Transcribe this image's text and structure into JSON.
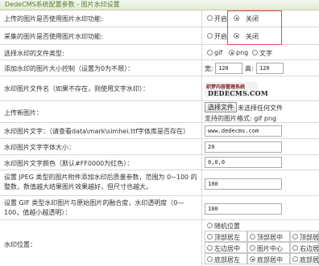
{
  "header": {
    "title": "DedeCMS系统配置参数 - 图片水印设置"
  },
  "rows": {
    "upload_wm": {
      "label": "上传的图片是否使用图片水印功能:",
      "opt_on": "开启",
      "opt_off": "关闭"
    },
    "collect_wm": {
      "label": "采集的图片是否使用图片水印功能:",
      "opt_on": "开启",
      "opt_off": "关闭"
    },
    "wm_type": {
      "label": "选择水印的文件类型:",
      "opt_gif": "gif",
      "opt_png": "png",
      "opt_text": "文字"
    },
    "wm_size": {
      "label": "添加水印的图片大小控制（设置为0为不限）：",
      "width_label": "宽:",
      "width": "120",
      "height_label": "高:",
      "height": "120"
    },
    "wm_file": {
      "label": "水印图片文件名（如果不存在，则使用文字水印）：",
      "preview_line1": "织梦内容管理系统",
      "preview_line2": "DEDECMS.COM"
    },
    "upload_new": {
      "label": "上传新图片：",
      "choose_btn": "选择文件",
      "no_file": "未选择任何文件",
      "support": "支持的图片格式: gif png"
    },
    "wm_text": {
      "label": "水印图片文字：（请查看data\\mark\\simhei.ttf字体库是否存在）",
      "value": "www.dedecms.com"
    },
    "wm_text_size": {
      "label": "水印图片文字字体大小：",
      "value": "20"
    },
    "wm_text_color": {
      "label": "水印图片文字颜色（默认#FF0000为红色）：",
      "value": "0,0,0"
    },
    "jpeg_quality": {
      "label": "设置 JPEG 类型的图片附件添加水印后质量参数，范围为 0~100 的整数，数值越大结果图片效果越好，但尺寸也越大。",
      "value": "100"
    },
    "gif_blend": {
      "label": "设置 GIF 类型水印图片与原始图片的融合度，水印透明度（0—100，值越小越透明）：",
      "value": "100"
    },
    "wm_pos": {
      "label": "水印位置：",
      "random": "随机位置",
      "top_left": "顶部居左",
      "top_center": "顶部居中",
      "top_right": "顶部居右",
      "mid_left": "左边居中",
      "center": "图片中心",
      "mid_right": "右边居中",
      "bottom_left": "底部居左",
      "bottom_center": "底部居中",
      "bottom_right": "底部居右"
    }
  }
}
